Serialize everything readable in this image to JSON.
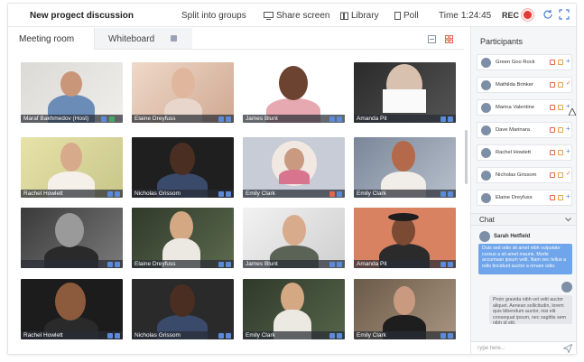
{
  "header": {
    "title": "New progect discussion",
    "split_label": "Split into groups",
    "share_label": "Share screen",
    "library_label": "Library",
    "poll_label": "Poll",
    "time_label": "Time",
    "time_value": "1:24:45",
    "rec_label": "REC"
  },
  "tabs": [
    {
      "label": "Meeting room",
      "active": true
    },
    {
      "label": "Whiteboard",
      "active": false
    }
  ],
  "participants_tiles": [
    {
      "name": "Maraf Bakhmedov (Host)"
    },
    {
      "name": "Elaine Dreyfuss"
    },
    {
      "name": "James Blunt"
    },
    {
      "name": "Amanda Pit"
    },
    {
      "name": "Rachel Howlett"
    },
    {
      "name": "Nicholas Grissom"
    },
    {
      "name": "Emily Clark"
    },
    {
      "name": "Emily Clark"
    },
    {
      "name": ""
    },
    {
      "name": "Elaine Dreyfuss"
    },
    {
      "name": "James Blunt"
    },
    {
      "name": "Amanda Pit"
    },
    {
      "name": "Rachel Howlett"
    },
    {
      "name": "Nicholas Grissom"
    },
    {
      "name": "Emily Clark"
    },
    {
      "name": "Emily Clark"
    }
  ],
  "sidebar": {
    "participants_title": "Participants",
    "participants": [
      {
        "name": "Green Goo Rock"
      },
      {
        "name": "Mathilda Brinker"
      },
      {
        "name": "Marina Valentine"
      },
      {
        "name": "Dave Marinara"
      },
      {
        "name": "Rachel Howlett"
      },
      {
        "name": "Nicholas Grissom"
      },
      {
        "name": "Elaine Dreyfuss"
      }
    ],
    "chat_title": "Chat",
    "messages": [
      {
        "sender": "Sarah Hetfield",
        "text": "Duis sed odio sit amet nibh vulputate cursus a sit amet mauris. Morbi accumsan ipsum velit. Nam nec tellus a odio tincidunt auctor a ornare odio."
      },
      {
        "sender": "",
        "text": "Proin gravida nibh vel velit auctor aliquet. Aenean sollicitudin, lorem quis bibendum auctor, nisi elit consequat ipsum, nec sagittis sem nibh id elit."
      }
    ],
    "input_placeholder": "Type here..."
  },
  "colors": {
    "accent": "#4a7fd6",
    "record": "#e53935",
    "chat_bubble": "#6fa5ea"
  }
}
